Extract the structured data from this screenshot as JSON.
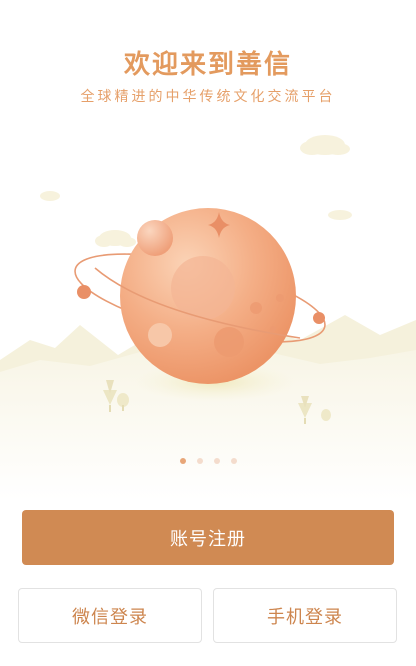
{
  "header": {
    "title": "欢迎来到善信",
    "subtitle": "全球精进的中华传统文化交流平台"
  },
  "illustration": {
    "icon": "planet-illustration",
    "colors": {
      "planet": "#f0a77e",
      "ground": "#f5f1dc",
      "accent": "#e08a5b"
    }
  },
  "carousel": {
    "page_count": 4,
    "active_index": 0
  },
  "buttons": {
    "register_label": "账号注册",
    "wechat_login_label": "微信登录",
    "phone_login_label": "手机登录"
  },
  "colors": {
    "brand": "#d08a53",
    "title": "#e39a5e",
    "secondary_border": "#e2e2e2"
  }
}
